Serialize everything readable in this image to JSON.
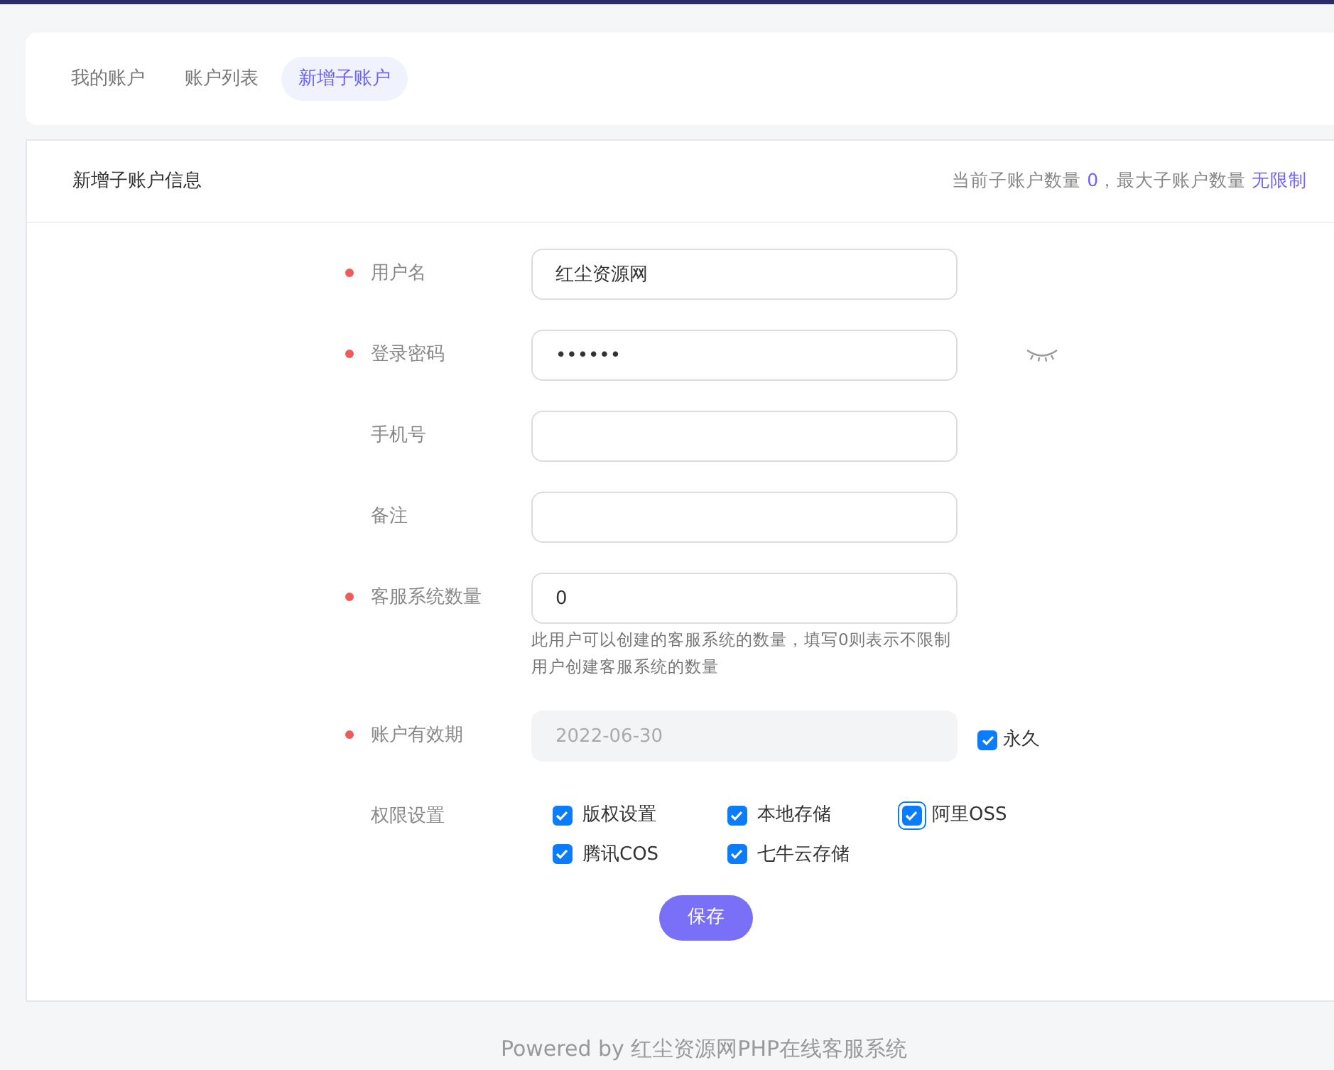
{
  "tabs": [
    {
      "label": "我的账户",
      "selected": false
    },
    {
      "label": "账户列表",
      "selected": false
    },
    {
      "label": "新增子账户",
      "selected": true
    }
  ],
  "panel": {
    "title": "新增子账户信息",
    "stats": [
      {
        "label": "当前子账户数量",
        "value": "0"
      },
      {
        "label": "，最大子账户数量",
        "value": "无限制"
      }
    ]
  },
  "fields": [
    {
      "label": "用户名",
      "required": true,
      "value": "红尘资源网"
    },
    {
      "label": "登录密码",
      "required": true,
      "value": "••••••",
      "reveal_toggle": true
    },
    {
      "label": "手机号",
      "required": false
    },
    {
      "label": "备注",
      "required": false
    },
    {
      "label": "客服系统数量",
      "required": true,
      "value": "0",
      "help": "此用户可以创建的客服系统的数量，填写0则表示不限制用户创建客服系统的数量"
    },
    {
      "label": "账户有效期",
      "required": true,
      "value": "2022-06-30",
      "disabled": true,
      "option": {
        "label": "永久",
        "checked": true
      }
    }
  ],
  "permissions": {
    "label": "权限设置",
    "items": [
      {
        "label": "版权设置",
        "checked": true,
        "focused": false
      },
      {
        "label": "本地存储",
        "checked": true,
        "focused": false
      },
      {
        "label": "阿里OSS",
        "checked": true,
        "focused": true
      },
      {
        "label": "腾讯COS",
        "checked": true,
        "focused": false
      },
      {
        "label": "七牛云存储",
        "checked": true,
        "focused": false
      }
    ]
  },
  "save_button": "保存",
  "footer": "Powered by 红尘资源网PHP在线客服系统"
}
